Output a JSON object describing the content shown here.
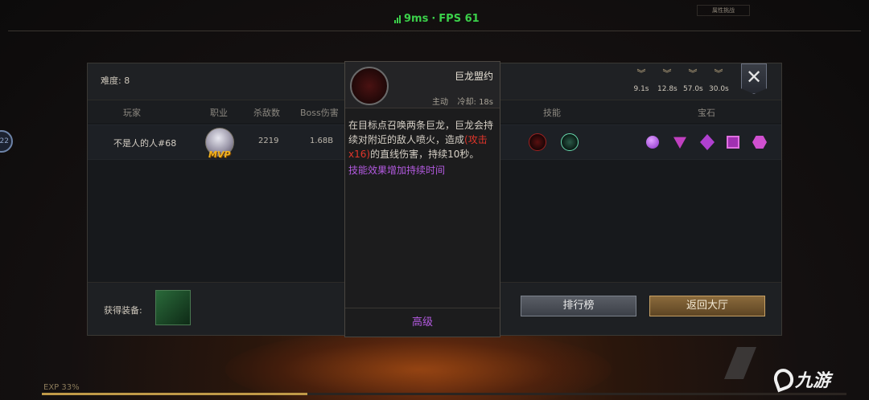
{
  "hud": {
    "latency": "9ms",
    "separator": "·",
    "fps": "FPS 61",
    "top_right_tag": "属性挑战",
    "side_badge": "22",
    "exp": "EXP 33%",
    "exp_progress": 0.33
  },
  "panel": {
    "difficulty": "难度: 8",
    "buffs": [
      {
        "time": "9.1s"
      },
      {
        "time": "12.8s"
      },
      {
        "time": "57.0s"
      },
      {
        "time": "30.0s"
      }
    ],
    "close_label": "✕",
    "columns": {
      "player": "玩家",
      "class": "职业",
      "kills": "杀敌数",
      "boss_damage": "Boss伤害",
      "skills": "技能",
      "gems": "宝石"
    },
    "row": {
      "player": "不是人的人#68",
      "badge": "MVP",
      "kills": "2219",
      "boss_damage": "1.68B"
    },
    "equip_label": "获得装备:",
    "buttons": {
      "rank": "排行榜",
      "lobby": "返回大厅"
    }
  },
  "tooltip": {
    "name": "巨龙盟约",
    "type": "主动",
    "cooldown": "冷却: 18s",
    "desc_part1": "在目标点召唤两条巨龙，巨龙会持续对附近的敌人喷火，造成",
    "desc_red": "(攻击x16)",
    "desc_part2": "的直线伤害，持续10秒。",
    "extra": "技能效果增加持续时间",
    "footer": "高级"
  },
  "logo": {
    "text": "九游"
  },
  "colors": {
    "accent_green": "#3bd04a",
    "purple": "#b35ae0",
    "red": "#e0352a",
    "gold": "#c6a064"
  },
  "icons": [
    "signal-icon",
    "buff-chevron-icon",
    "close-icon",
    "dragon-icon",
    "avatar",
    "gem-icon"
  ]
}
